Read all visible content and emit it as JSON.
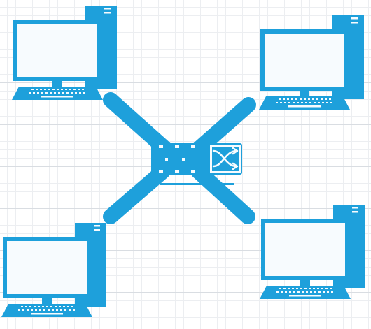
{
  "diagram": {
    "type": "network-star-topology",
    "colors": {
      "device": "#1ea0db",
      "link": "#1ea0db",
      "screen": "#f7fbfe",
      "background": "#ffffff",
      "grid_major": "#d9dde2",
      "grid_minor": "#eceef1"
    },
    "hub": {
      "icon": "network-switch-icon"
    },
    "nodes": [
      {
        "id": "computer-top-left",
        "icon": "desktop-computer-icon"
      },
      {
        "id": "computer-top-right",
        "icon": "desktop-computer-icon"
      },
      {
        "id": "computer-bottom-left",
        "icon": "desktop-computer-icon"
      },
      {
        "id": "computer-bottom-right",
        "icon": "desktop-computer-icon"
      }
    ],
    "links": [
      {
        "from": "hub",
        "to": "computer-top-left"
      },
      {
        "from": "hub",
        "to": "computer-top-right"
      },
      {
        "from": "hub",
        "to": "computer-bottom-left"
      },
      {
        "from": "hub",
        "to": "computer-bottom-right"
      }
    ]
  }
}
